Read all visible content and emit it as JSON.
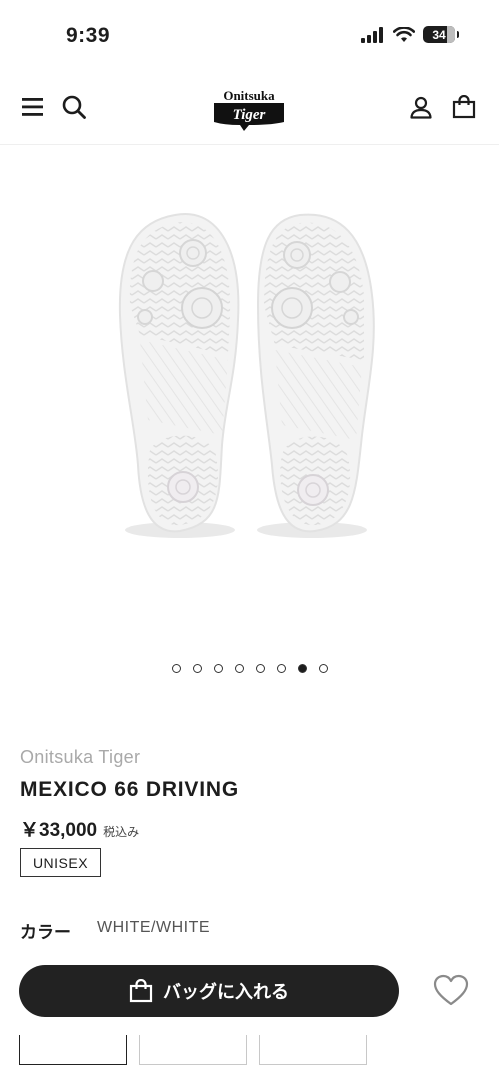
{
  "status": {
    "time": "9:39",
    "battery": "34"
  },
  "header": {
    "logo_line1": "Onitsuka",
    "logo_line2": "Tiger"
  },
  "carousel": {
    "total": 8,
    "active_index": 6
  },
  "product": {
    "brand": "Onitsuka Tiger",
    "name": "MEXICO 66 DRIVING",
    "price": "￥33,000",
    "tax_note": "税込み",
    "badge": "UNISEX",
    "color_label": "カラー",
    "color_value": "WHITE/WHITE"
  },
  "actions": {
    "add_to_bag": "バッグに入れる"
  },
  "sizes": {
    "count": 3,
    "selected_index": 0
  }
}
